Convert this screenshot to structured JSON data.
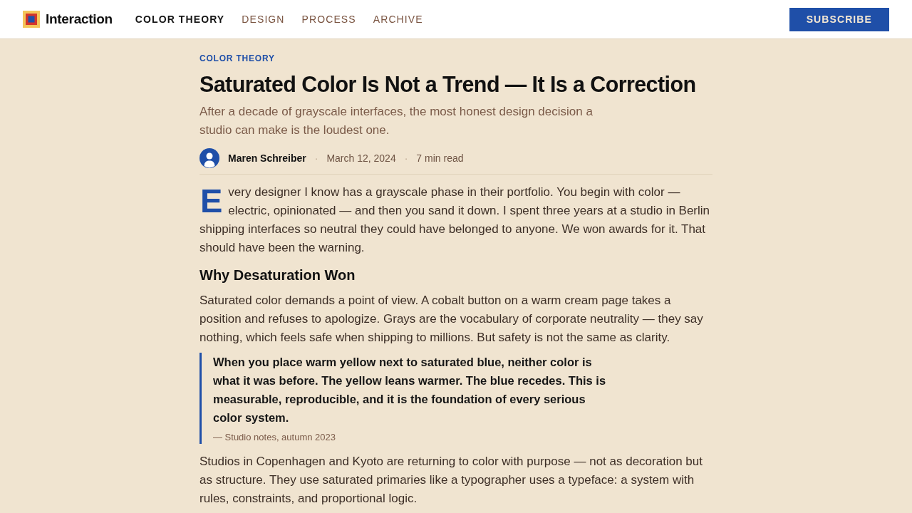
{
  "header": {
    "brand": "Interaction",
    "nav": [
      {
        "label": "COLOR THEORY",
        "selected": true
      },
      {
        "label": "DESIGN",
        "selected": false
      },
      {
        "label": "PROCESS",
        "selected": false
      },
      {
        "label": "ARCHIVE",
        "selected": false
      }
    ],
    "subscribe_button": "SUBSCRIBE"
  },
  "article": {
    "category": "COLOR THEORY",
    "title": "Saturated Color Is Not a Trend — It Is a Correction",
    "subtitle": "After a decade of grayscale interfaces, the most honest design decision a studio can make is the loudest one.",
    "byline": [
      {
        "kind": "author",
        "text": "Maren Schreiber"
      },
      {
        "kind": "separator",
        "text": "·"
      },
      {
        "kind": "date",
        "text": "March 12, 2024"
      },
      {
        "kind": "separator",
        "text": "·"
      },
      {
        "kind": "reading_time",
        "text": "7 min read"
      }
    ],
    "body": [
      {
        "kind": "paragraph",
        "drop_cap": true,
        "text": "Every designer I know has a grayscale phase in their portfolio. You begin with color — electric, opinionated — and then you sand it down. I spent three years at a studio in Berlin shipping interfaces so neutral they could have belonged to anyone. We won awards for it. That should have been the warning."
      },
      {
        "kind": "heading",
        "text": "Why Desaturation Won"
      },
      {
        "kind": "paragraph",
        "drop_cap": false,
        "text": "Saturated color demands a point of view. A cobalt button on a warm cream page takes a position and refuses to apologize. Grays are the vocabulary of corporate neutrality — they say nothing, which feels safe when shipping to millions. But safety is not the same as clarity."
      },
      {
        "kind": "quote",
        "text": "When you place warm yellow next to saturated blue, neither color is what it was before. The yellow leans warmer. The blue recedes. This is measurable, reproducible, and it is the foundation of every serious color system.",
        "attribution": "— Studio notes, autumn 2023"
      },
      {
        "kind": "paragraph",
        "drop_cap": false,
        "text": "Studios in Copenhagen and Kyoto are returning to color with purpose — not as decoration but as structure. They use saturated primaries like a typographer uses a typeface: a system with rules, constraints, and proportional logic."
      }
    ]
  }
}
